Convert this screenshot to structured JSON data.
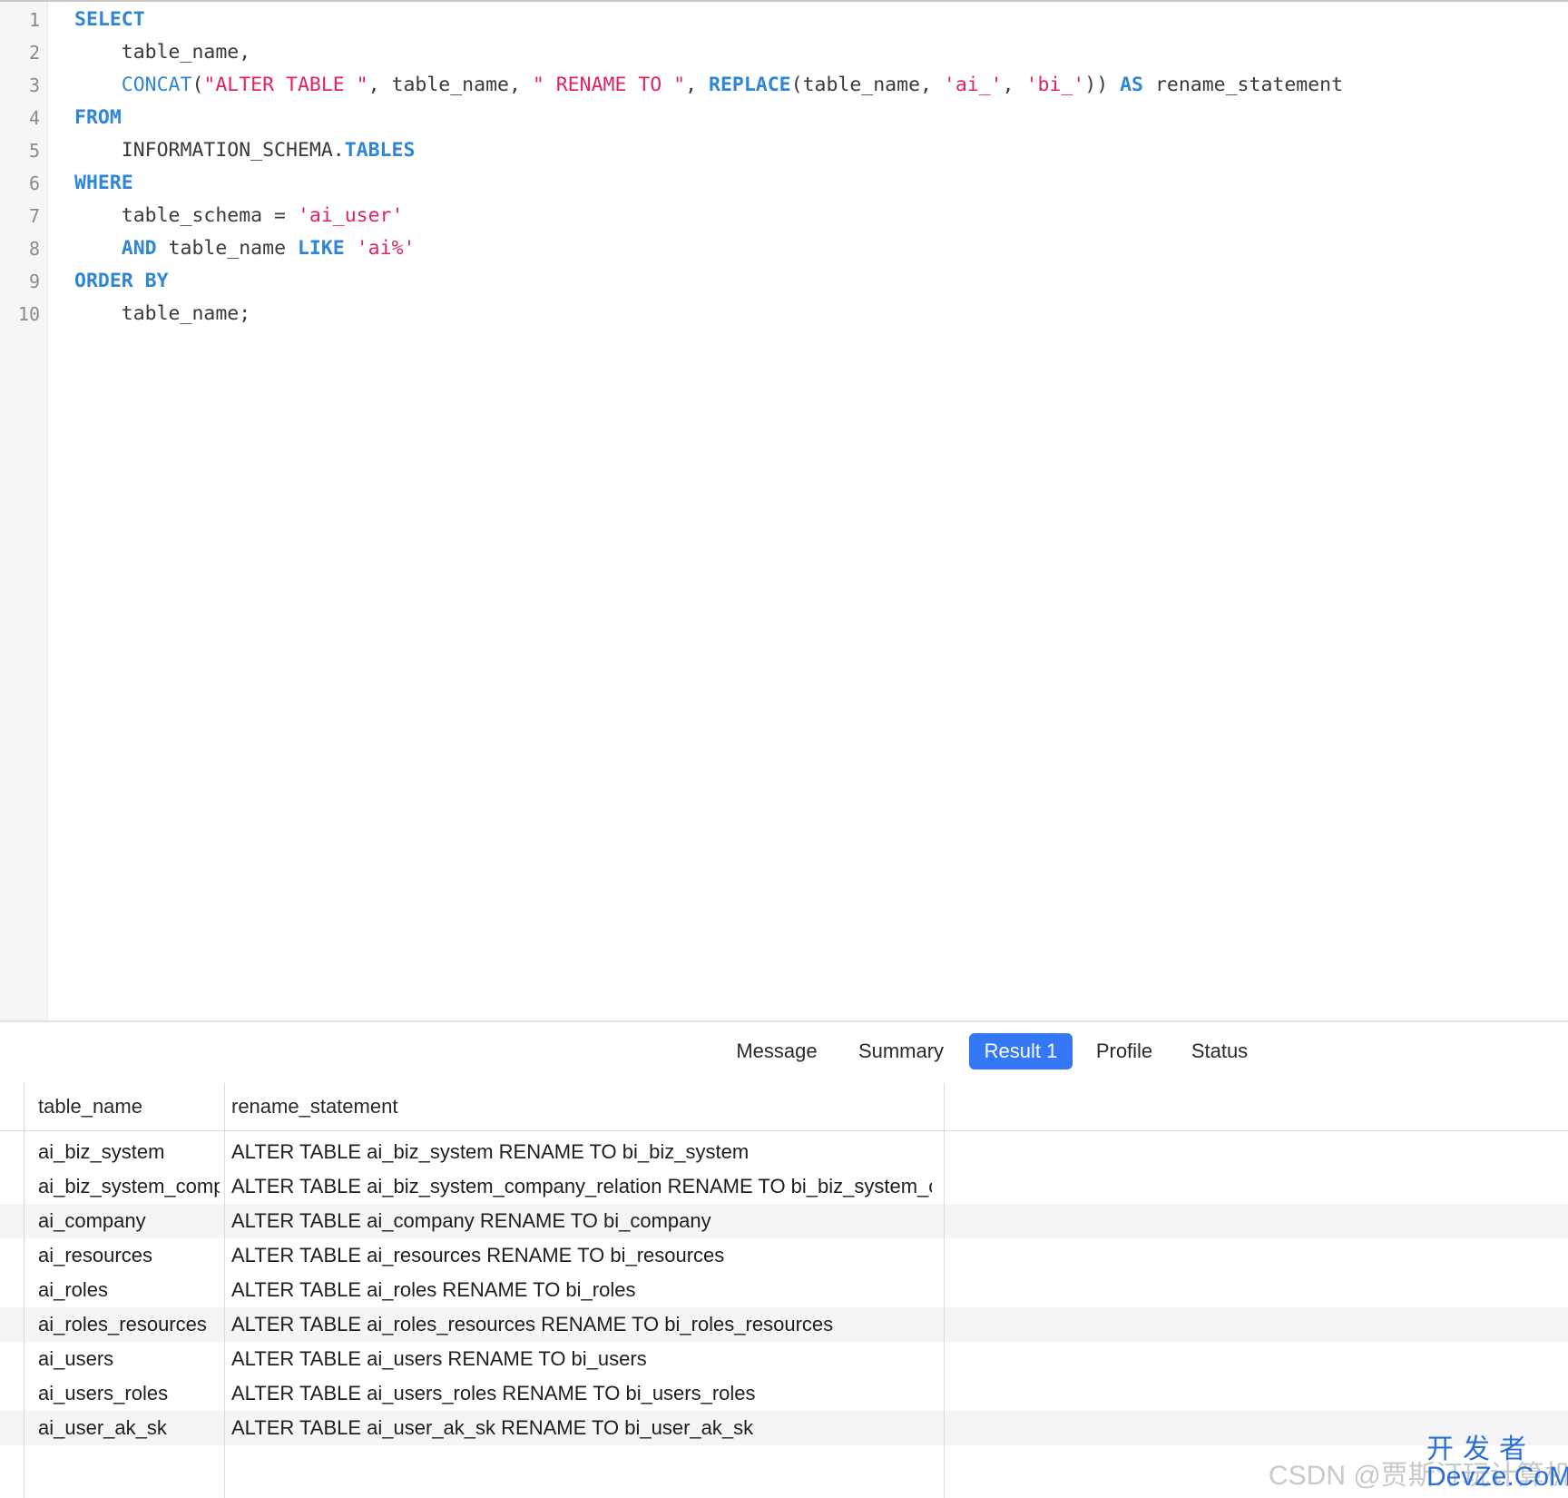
{
  "editor": {
    "lines": [
      {
        "num": "1",
        "tokens": [
          {
            "t": "SELECT",
            "c": "kw"
          }
        ]
      },
      {
        "num": "2",
        "tokens": [
          {
            "t": "    table_name,",
            "c": "plain"
          }
        ]
      },
      {
        "num": "3",
        "tokens": [
          {
            "t": "    ",
            "c": "plain"
          },
          {
            "t": "CONCAT",
            "c": "fn"
          },
          {
            "t": "(",
            "c": "plain"
          },
          {
            "t": "\"ALTER TABLE \"",
            "c": "str"
          },
          {
            "t": ", table_name, ",
            "c": "plain"
          },
          {
            "t": "\" RENAME TO \"",
            "c": "str"
          },
          {
            "t": ", ",
            "c": "plain"
          },
          {
            "t": "REPLACE",
            "c": "kw"
          },
          {
            "t": "(table_name, ",
            "c": "plain"
          },
          {
            "t": "'ai_'",
            "c": "str"
          },
          {
            "t": ", ",
            "c": "plain"
          },
          {
            "t": "'bi_'",
            "c": "str"
          },
          {
            "t": ")) ",
            "c": "plain"
          },
          {
            "t": "AS",
            "c": "kw"
          },
          {
            "t": " rename_statement",
            "c": "plain"
          }
        ]
      },
      {
        "num": "4",
        "tokens": [
          {
            "t": "FROM",
            "c": "kw"
          }
        ]
      },
      {
        "num": "5",
        "tokens": [
          {
            "t": "    INFORMATION_SCHEMA.",
            "c": "plain"
          },
          {
            "t": "TABLES",
            "c": "kw"
          }
        ]
      },
      {
        "num": "6",
        "tokens": [
          {
            "t": "WHERE",
            "c": "kw"
          }
        ]
      },
      {
        "num": "7",
        "tokens": [
          {
            "t": "    table_schema = ",
            "c": "plain"
          },
          {
            "t": "'ai_user'",
            "c": "str"
          }
        ]
      },
      {
        "num": "8",
        "tokens": [
          {
            "t": "    ",
            "c": "plain"
          },
          {
            "t": "AND",
            "c": "kw"
          },
          {
            "t": " table_name ",
            "c": "plain"
          },
          {
            "t": "LIKE",
            "c": "kw"
          },
          {
            "t": " ",
            "c": "plain"
          },
          {
            "t": "'ai%'",
            "c": "str"
          }
        ]
      },
      {
        "num": "9",
        "tokens": [
          {
            "t": "ORDER BY",
            "c": "kw"
          }
        ]
      },
      {
        "num": "10",
        "tokens": [
          {
            "t": "    table_name;",
            "c": "plain"
          }
        ]
      }
    ]
  },
  "tabs": {
    "message": "Message",
    "summary": "Summary",
    "result1": "Result 1",
    "profile": "Profile",
    "status": "Status",
    "active": "Result 1"
  },
  "results": {
    "columns": [
      "table_name",
      "rename_statement"
    ],
    "rows": [
      [
        "ai_biz_system",
        "ALTER TABLE ai_biz_system RENAME TO bi_biz_system"
      ],
      [
        "ai_biz_system_company_relation",
        "ALTER TABLE ai_biz_system_company_relation RENAME TO bi_biz_system_company_relation"
      ],
      [
        "ai_company",
        "ALTER TABLE ai_company RENAME TO bi_company"
      ],
      [
        "ai_resources",
        "ALTER TABLE ai_resources RENAME TO bi_resources"
      ],
      [
        "ai_roles",
        "ALTER TABLE ai_roles RENAME TO bi_roles"
      ],
      [
        "ai_roles_resources",
        "ALTER TABLE ai_roles_resources RENAME TO bi_roles_resources"
      ],
      [
        "ai_users",
        "ALTER TABLE ai_users RENAME TO bi_users"
      ],
      [
        "ai_users_roles",
        "ALTER TABLE ai_users_roles RENAME TO bi_users_roles"
      ],
      [
        "ai_user_ak_sk",
        "ALTER TABLE ai_user_ak_sk RENAME TO bi_user_ak_sk"
      ]
    ]
  },
  "watermark": {
    "csdn": "CSDN @贾斯汀玩计算机",
    "logo_cn": "开发者",
    "logo_en": "DevZe.CoM"
  }
}
